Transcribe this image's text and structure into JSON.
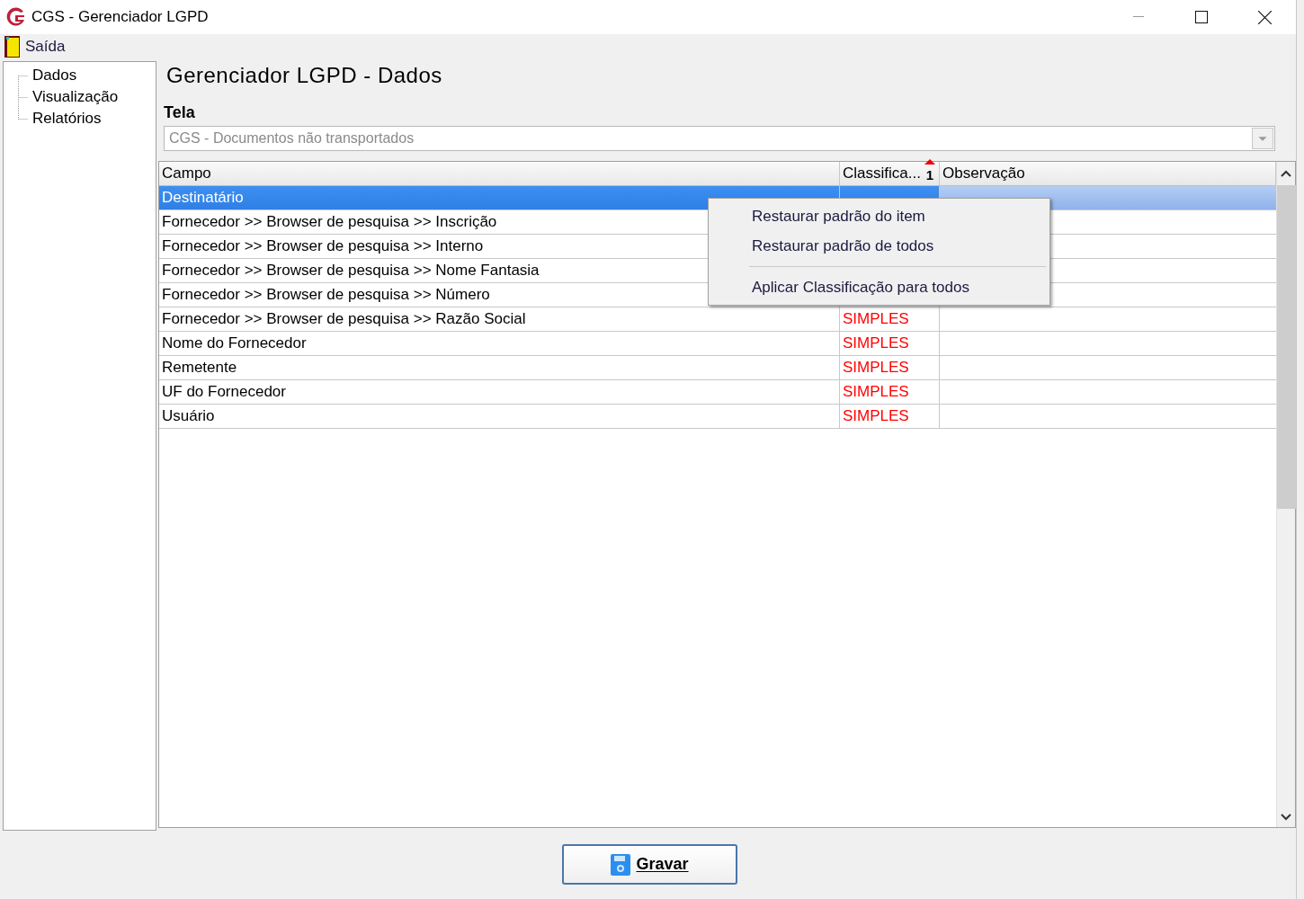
{
  "window": {
    "title": "CGS - Gerenciador LGPD"
  },
  "menu_bar": [
    {
      "label": "Saída"
    }
  ],
  "sidebar": {
    "items": [
      {
        "label": "Dados"
      },
      {
        "label": "Visualização"
      },
      {
        "label": "Relatórios"
      }
    ]
  },
  "heading": "Gerenciador LGPD - Dados",
  "tela": {
    "label": "Tela",
    "value": "CGS - Documentos não transportados"
  },
  "table": {
    "columns": [
      {
        "label": "Campo"
      },
      {
        "label": "Classifica...",
        "sort_mark": "1"
      },
      {
        "label": "Observação"
      }
    ],
    "rows": [
      {
        "campo": "Destinatário",
        "selected": true
      },
      {
        "campo": "Fornecedor >> Browser de pesquisa >> Inscrição",
        "selected": false
      },
      {
        "campo": "Fornecedor >> Browser de pesquisa >> Interno",
        "selected": false
      },
      {
        "campo": "Fornecedor >> Browser de pesquisa >> Nome Fantasia",
        "selected": false
      },
      {
        "campo": "Fornecedor >> Browser de pesquisa >> Número",
        "selected": false
      },
      {
        "campo": "Fornecedor >> Browser de pesquisa >> Razão Social",
        "classificacao": "SIMPLES",
        "selected": false
      },
      {
        "campo": "Nome do Fornecedor",
        "classificacao": "SIMPLES",
        "selected": false
      },
      {
        "campo": "Remetente",
        "classificacao": "SIMPLES",
        "selected": false
      },
      {
        "campo": "UF do Fornecedor",
        "classificacao": "SIMPLES",
        "selected": false
      },
      {
        "campo": "Usuário",
        "classificacao": "SIMPLES",
        "selected": false
      }
    ]
  },
  "context_menu": [
    {
      "kind": "item",
      "label": "Restaurar padrão do item"
    },
    {
      "kind": "item",
      "label": "Restaurar padrão de todos"
    },
    {
      "kind": "separator"
    },
    {
      "kind": "item",
      "label": "Aplicar Classificação para todos"
    }
  ],
  "save_button": {
    "label": "Gravar"
  }
}
